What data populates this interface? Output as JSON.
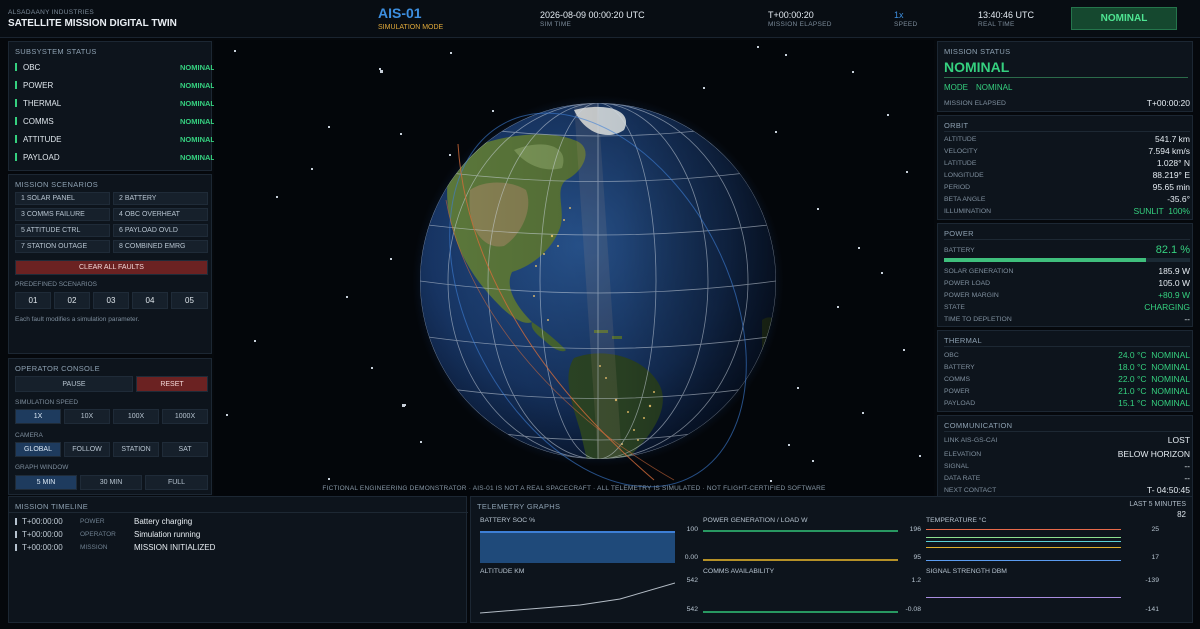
{
  "header": {
    "company": "ALSADAANY INDUSTRIES",
    "title": "SATELLITE MISSION DIGITAL TWIN",
    "sat_id": "AIS-01",
    "mode_label": "SIMULATION MODE",
    "sim_time": "2026-08-09 00:00:20 UTC",
    "sim_time_label": "SIM TIME",
    "elapsed": "T+00:00:20",
    "elapsed_label": "MISSION ELAPSED",
    "speed": "1x",
    "speed_label": "SPEED",
    "real_time": "13:40:46 UTC",
    "real_time_label": "REAL TIME",
    "status_badge": "NOMINAL"
  },
  "subsystems": {
    "title": "SUBSYSTEM STATUS",
    "items": [
      {
        "name": "OBC",
        "status": "NOMINAL"
      },
      {
        "name": "POWER",
        "status": "NOMINAL"
      },
      {
        "name": "THERMAL",
        "status": "NOMINAL"
      },
      {
        "name": "COMMS",
        "status": "NOMINAL"
      },
      {
        "name": "ATTITUDE",
        "status": "NOMINAL"
      },
      {
        "name": "PAYLOAD",
        "status": "NOMINAL"
      }
    ]
  },
  "scenarios": {
    "title": "MISSION SCENARIOS",
    "faults": [
      "1 SOLAR PANEL",
      "2 BATTERY",
      "3 COMMS FAILURE",
      "4 OBC OVERHEAT",
      "5 ATTITUDE CTRL",
      "6 PAYLOAD OVLD",
      "7 STATION OUTAGE",
      "8 COMBINED EMRG"
    ],
    "clear_label": "CLEAR ALL FAULTS",
    "predefined_label": "PREDEFINED SCENARIOS",
    "predefined": [
      "01",
      "02",
      "03",
      "04",
      "05"
    ],
    "note": "Each fault modifies a simulation parameter."
  },
  "console": {
    "title": "OPERATOR CONSOLE",
    "pause": "PAUSE",
    "reset": "RESET",
    "speed_label": "SIMULATION SPEED",
    "speeds": [
      "1X",
      "10X",
      "100X",
      "1000X"
    ],
    "camera_label": "CAMERA",
    "cameras": [
      "GLOBAL",
      "FOLLOW",
      "STATION",
      "SAT"
    ],
    "graph_label": "GRAPH WINDOW",
    "windows": [
      "5 MIN",
      "30 MIN",
      "FULL"
    ]
  },
  "viewport": {
    "disclaimer": "FICTIONAL ENGINEERING DEMONSTRATOR  ·  AIS-01 IS NOT A REAL SPACECRAFT  ·  ALL TELEMETRY IS SIMULATED  ·  NOT FLIGHT-CERTIFIED SOFTWARE"
  },
  "mission_status": {
    "title": "MISSION STATUS",
    "status": "NOMINAL",
    "mode_label": "MODE",
    "mode_value": "NOMINAL",
    "elapsed_label": "MISSION ELAPSED",
    "elapsed_value": "T+00:00:20"
  },
  "orbit": {
    "title": "ORBIT",
    "rows": [
      {
        "k": "ALTITUDE",
        "v": "541.7 km"
      },
      {
        "k": "VELOCITY",
        "v": "7.594 km/s"
      },
      {
        "k": "LATITUDE",
        "v": "1.028° N"
      },
      {
        "k": "LONGITUDE",
        "v": "88.219° E"
      },
      {
        "k": "PERIOD",
        "v": "95.65 min"
      },
      {
        "k": "BETA ANGLE",
        "v": "-35.6°"
      },
      {
        "k": "ILLUMINATION",
        "v": "SUNLIT  100%"
      }
    ]
  },
  "power": {
    "title": "POWER",
    "battery_label": "BATTERY",
    "battery_value": "82.1 %",
    "battery_fraction": 0.821,
    "rows": [
      {
        "k": "SOLAR GENERATION",
        "v": "185.9 W"
      },
      {
        "k": "POWER LOAD",
        "v": "105.0 W"
      },
      {
        "k": "POWER MARGIN",
        "v": "+80.9 W"
      },
      {
        "k": "STATE",
        "v": "CHARGING"
      },
      {
        "k": "TIME TO DEPLETION",
        "v": "--"
      }
    ]
  },
  "thermal": {
    "title": "THERMAL",
    "rows": [
      {
        "k": "OBC",
        "v": "24.0 °C  NOMINAL"
      },
      {
        "k": "BATTERY",
        "v": "18.0 °C  NOMINAL"
      },
      {
        "k": "COMMS",
        "v": "22.0 °C  NOMINAL"
      },
      {
        "k": "POWER",
        "v": "21.0 °C  NOMINAL"
      },
      {
        "k": "PAYLOAD",
        "v": "15.1 °C  NOMINAL"
      }
    ]
  },
  "communication": {
    "title": "COMMUNICATION",
    "rows": [
      {
        "k": "LINK  AIS-GS-CAI",
        "v": "LOST"
      },
      {
        "k": "ELEVATION",
        "v": "BELOW HORIZON"
      },
      {
        "k": "SIGNAL",
        "v": "--"
      },
      {
        "k": "DATA RATE",
        "v": "--"
      },
      {
        "k": "NEXT CONTACT",
        "v": "T- 04:50:45"
      }
    ]
  },
  "timeline": {
    "title": "MISSION TIMELINE",
    "events": [
      {
        "time": "T+00:00:00",
        "cat": "POWER",
        "msg": "Battery charging"
      },
      {
        "time": "T+00:00:00",
        "cat": "OPERATOR",
        "msg": "Simulation running"
      },
      {
        "time": "T+00:00:00",
        "cat": "MISSION",
        "msg": "MISSION INITIALIZED"
      }
    ]
  },
  "telemetry": {
    "title": "TELEMETRY GRAPHS",
    "window": "LAST 5 MINUTES",
    "count": "82",
    "graphs": [
      {
        "title": "BATTERY SOC  %",
        "max": "100",
        "min": "0.00"
      },
      {
        "title": "POWER  GENERATION / LOAD  W",
        "max": "196",
        "min": "95"
      },
      {
        "title": "TEMPERATURE  °C",
        "max": "25",
        "min": "17"
      },
      {
        "title": "ALTITUDE  km",
        "max": "542",
        "min": "542"
      },
      {
        "title": "COMMS AVAILABILITY",
        "max": "1.2",
        "min": "-0.08"
      },
      {
        "title": "SIGNAL STRENGTH  dBm",
        "max": "-139",
        "min": "-141"
      }
    ]
  },
  "colors": {
    "accent_green": "#35d07f",
    "accent_blue": "#3d8fe0",
    "danger": "#6b2222"
  }
}
